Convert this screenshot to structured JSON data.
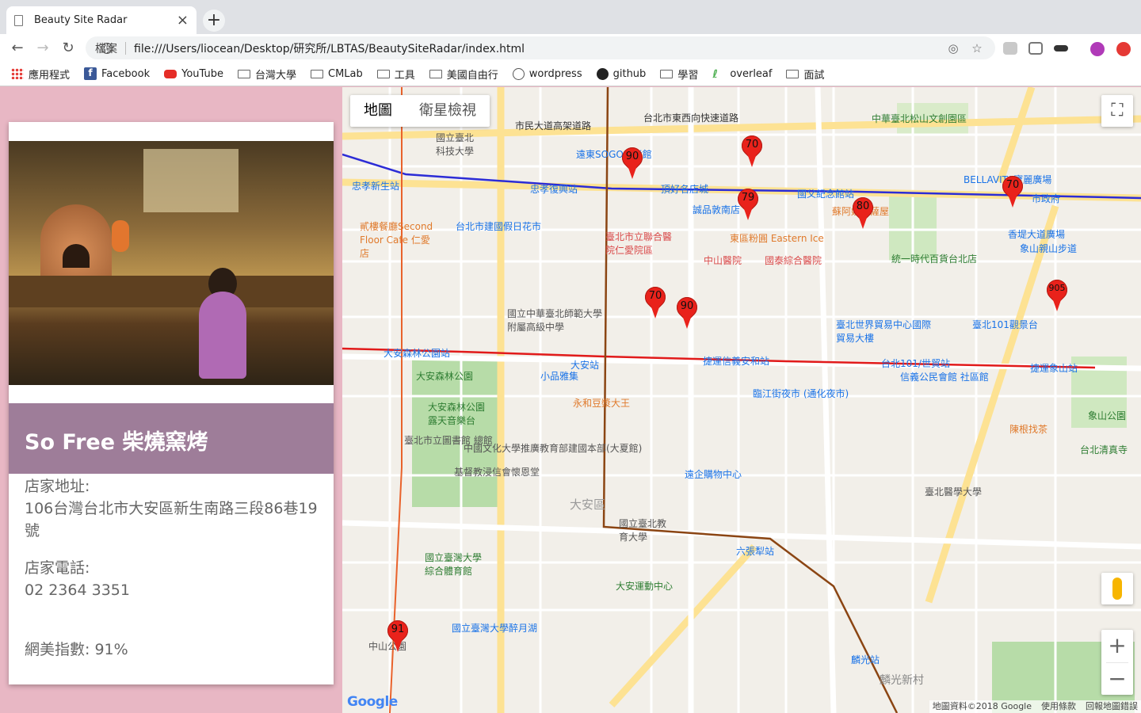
{
  "browser": {
    "tab_title": "Beauty Site Radar",
    "tab_close": "×",
    "new_tab": "+",
    "address_label": "檔案",
    "url": "file:///Users/liocean/Desktop/研究所/LBTAS/BeautySiteRadar/index.html",
    "bookmarks": [
      "應用程式",
      "Facebook",
      "YouTube",
      "台灣大學",
      "CMLab",
      "工具",
      "美國自由行",
      "wordpress",
      "github",
      "學習",
      "overleaf",
      "面試"
    ]
  },
  "card": {
    "shop_name": "So Free 柴燒窯烤",
    "address_label": "店家地址:",
    "address": "106台灣台北市大安區新生南路三段86巷19號",
    "phone_label": "店家電話:",
    "phone": "02 2364 3351",
    "beauty_index": "網美指數: 91%"
  },
  "map": {
    "type_map": "地圖",
    "type_satellite": "衛星檢視",
    "attribution": "地圖資料©2018 Google",
    "terms": "使用條款",
    "report": "回報地圖錯誤",
    "google": "Google",
    "markers": [
      "90",
      "70",
      "79",
      "80",
      "70",
      "70",
      "90",
      "905",
      "91"
    ],
    "labels": {
      "roads": [
        "市民大道高架道路",
        "台北市東西向快速道路",
        "忠孝復興站",
        "忠孝新生站",
        "大安森林公園站",
        "大安站",
        "捷運信義安和站",
        "台北101/世貿站",
        "捷運象山站",
        "六張犁站",
        "麟光站",
        "國父紀念館站",
        "市政府"
      ],
      "places": [
        "遠東SOGO忠孝館",
        "頂好名店城",
        "誠品敦南店",
        "東區粉圓 Eastern Ice",
        "蘇阿姨比薩屋",
        "中山醫院",
        "國泰綜合醫院",
        "台北市建國假日花市",
        "臺北市立聯合醫院仁愛院區",
        "國立中華臺北師範大學附屬高級中學",
        "大安森林公園",
        "大安森林公園露天音樂台",
        "小品雅集",
        "永和豆漿大王",
        "臨江街夜市 (通化夜市)",
        "臺北世界貿易中心國際貿易大樓",
        "臺北101觀景台",
        "信義公民會館 社區館",
        "遠企購物中心",
        "國立臺北教育大學",
        "大安運動中心",
        "國立臺灣大學綜合體育館",
        "臺北醫學大學",
        "象山公園",
        "台北清真寺",
        "臺北市立圖書館 總館",
        "中國文化大學推廣教育部建國本部(大夏館)",
        "基督教浸信會懷恩堂",
        "中山公園",
        "統一時代百貨台北店",
        "BELLAVITA寶麗廣場",
        "香堤大道廣場",
        "象山親山步道",
        "陳根找茶",
        "貳樓餐廳Second Floor Cafe 仁愛店",
        "國立臺灣大學醉月湖",
        "大安區",
        "麟光新村",
        "中華臺北松山文創園區",
        "國立臺北科技大學"
      ]
    }
  }
}
